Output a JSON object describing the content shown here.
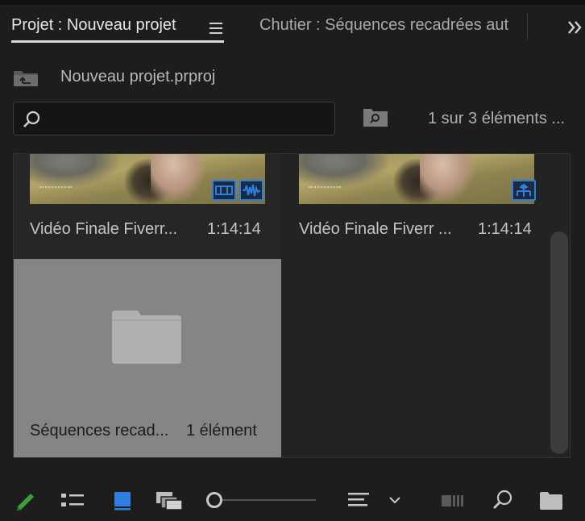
{
  "tabs": {
    "active_label": "Projet : Nouveau projet",
    "inactive_label": "Chutier : Séquences recadrées aut"
  },
  "path": {
    "label": "Nouveau projet.prproj"
  },
  "search": {
    "value": "",
    "placeholder": ""
  },
  "item_count": "1 sur 3 éléments ...",
  "items": [
    {
      "name": "Vidéo Finale Fiverr...",
      "duration": "1:14:14",
      "badge": "video-audio-clip"
    },
    {
      "name": "Vidéo Finale Fiverr ...",
      "duration": "1:14:14",
      "badge": "sequence"
    },
    {
      "name": "Séquences recad...",
      "count": "1 élément",
      "badge": "bin"
    }
  ],
  "colors": {
    "accent_blue": "#2f7fe0",
    "pencil_green": "#3aa13a",
    "selected_tile": "#858585"
  }
}
